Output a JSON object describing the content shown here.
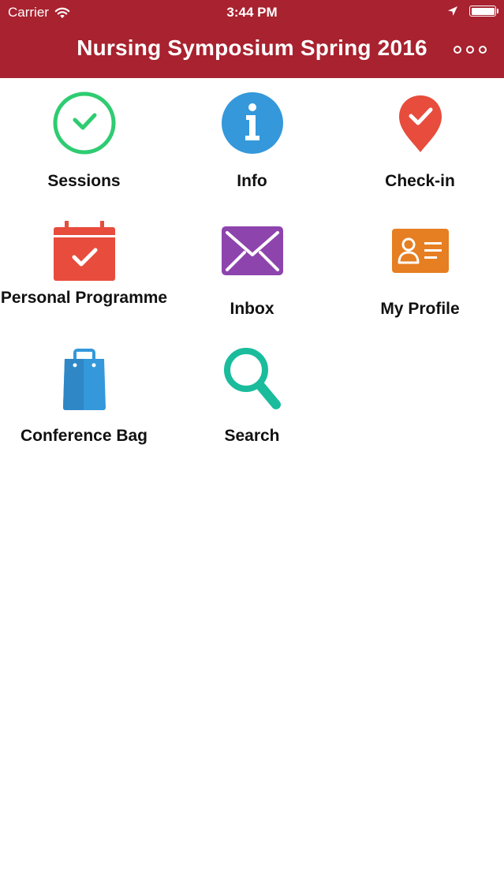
{
  "status_bar": {
    "carrier": "Carrier",
    "time": "3:44 PM"
  },
  "nav": {
    "title": "Nursing Symposium Spring 2016",
    "more_icon": "ellipsis-icon"
  },
  "colors": {
    "header_bg": "#a8222f",
    "sessions": "#2ecc71",
    "info": "#3498db",
    "checkin": "#e74c3c",
    "personal_programme": "#e74c3c",
    "inbox": "#8e44ad",
    "my_profile": "#e67e22",
    "conference_bag": "#3498db",
    "search": "#1abc9c"
  },
  "menu": [
    {
      "label": "Sessions",
      "icon": "clock-check-icon"
    },
    {
      "label": "Info",
      "icon": "info-icon"
    },
    {
      "label": "Check-in",
      "icon": "location-check-icon"
    },
    {
      "label": "Personal Programme",
      "icon": "calendar-check-icon"
    },
    {
      "label": "Inbox",
      "icon": "envelope-icon"
    },
    {
      "label": "My Profile",
      "icon": "id-card-icon"
    },
    {
      "label": "Conference Bag",
      "icon": "shopping-bag-icon"
    },
    {
      "label": "Search",
      "icon": "magnifier-icon"
    }
  ]
}
